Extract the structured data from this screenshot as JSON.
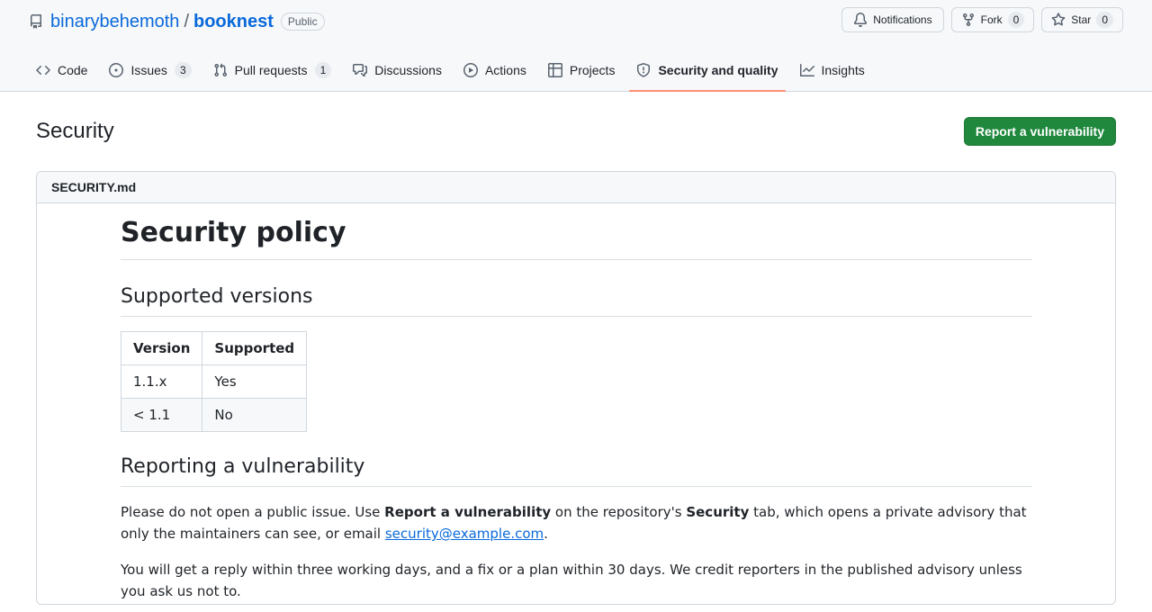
{
  "repo": {
    "owner": "binarybehemoth",
    "slash": "/",
    "name": "booknest",
    "visibility": "Public"
  },
  "header_actions": {
    "notifications_label": "Notifications",
    "fork_label": "Fork",
    "fork_count": "0",
    "star_label": "Star",
    "star_count": "0"
  },
  "nav": [
    {
      "label": "Code",
      "icon": "code-icon"
    },
    {
      "label": "Issues",
      "count": "3",
      "icon": "issue-icon"
    },
    {
      "label": "Pull requests",
      "count": "1",
      "icon": "pull-request-icon"
    },
    {
      "label": "Discussions",
      "icon": "discussions-icon"
    },
    {
      "label": "Actions",
      "icon": "play-icon"
    },
    {
      "label": "Projects",
      "icon": "table-icon"
    },
    {
      "label": "Security and quality",
      "icon": "shield-icon",
      "active": true
    },
    {
      "label": "Insights",
      "icon": "graph-icon"
    }
  ],
  "page": {
    "title": "Security",
    "report_button": "Report a vulnerability"
  },
  "file": {
    "name": "SECURITY.md",
    "h1": "Security policy",
    "h2_versions": "Supported versions",
    "table": {
      "headers": [
        "Version",
        "Supported"
      ],
      "rows": [
        [
          "1.1.x",
          "Yes"
        ],
        [
          "< 1.1",
          "No"
        ]
      ]
    },
    "h2_reporting": "Reporting a vulnerability",
    "p1": {
      "t1": "Please do not open a public issue. Use ",
      "b1": "Report a vulnerability",
      "t2": " on the repository's ",
      "b2": "Security",
      "t3": " tab, which opens a private advisory that only the maintainers can see, or email ",
      "email": "security@example.com",
      "t4": "."
    },
    "p2": "You will get a reply within three working days, and a fix or a plan within 30 days. We credit reporters in the published advisory unless you ask us not to."
  },
  "colors": {
    "accent": "#0969da",
    "primary_button": "#1f883d",
    "active_underline": "#fd8c73"
  }
}
